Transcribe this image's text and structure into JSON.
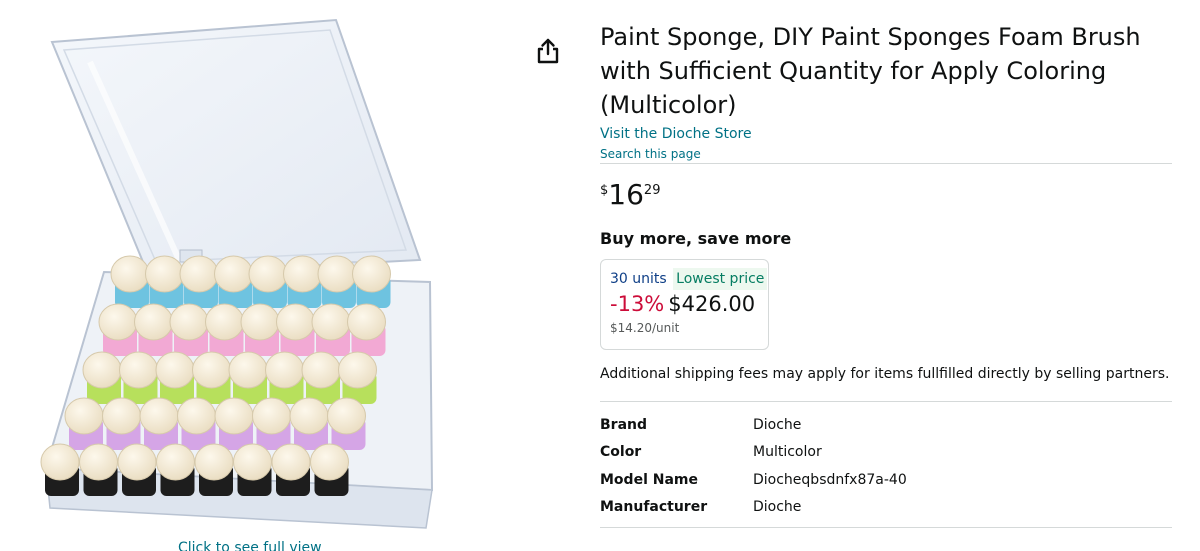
{
  "product": {
    "title": "Paint Sponge, DIY Paint Sponges Foam Brush with Sufficient Quantity for Apply Coloring (Multicolor)",
    "store_link": "Visit the Dioche Store",
    "search_link": "Search this page"
  },
  "image": {
    "caption": "Click to see full view",
    "sponge_colors": [
      "#6ec3e0",
      "#f2a9d4",
      "#b7e05c",
      "#d5a5e6",
      "#1d1d1d"
    ]
  },
  "icons": {
    "share": "share-icon"
  },
  "price": {
    "symbol": "$",
    "whole": "16",
    "fraction": "29"
  },
  "buy_more": {
    "heading": "Buy more, save more",
    "tier": {
      "units": "30 units",
      "badge": "Lowest price",
      "discount": "-13%",
      "price": "$426.00",
      "unit_price": "$14.20/unit"
    }
  },
  "shipping_note": "Additional shipping fees may apply for items fullfilled directly by selling partners.",
  "specs": [
    {
      "key": "Brand",
      "value": "Dioche"
    },
    {
      "key": "Color",
      "value": "Multicolor"
    },
    {
      "key": "Model Name",
      "value": "Diocheqbsdnfx87a-40"
    },
    {
      "key": "Manufacturer",
      "value": "Dioche"
    }
  ],
  "colors": {
    "link": "#007185",
    "discount": "#CC0C39",
    "badge_text": "#067D62",
    "badge_bg": "#EDF8EF"
  }
}
